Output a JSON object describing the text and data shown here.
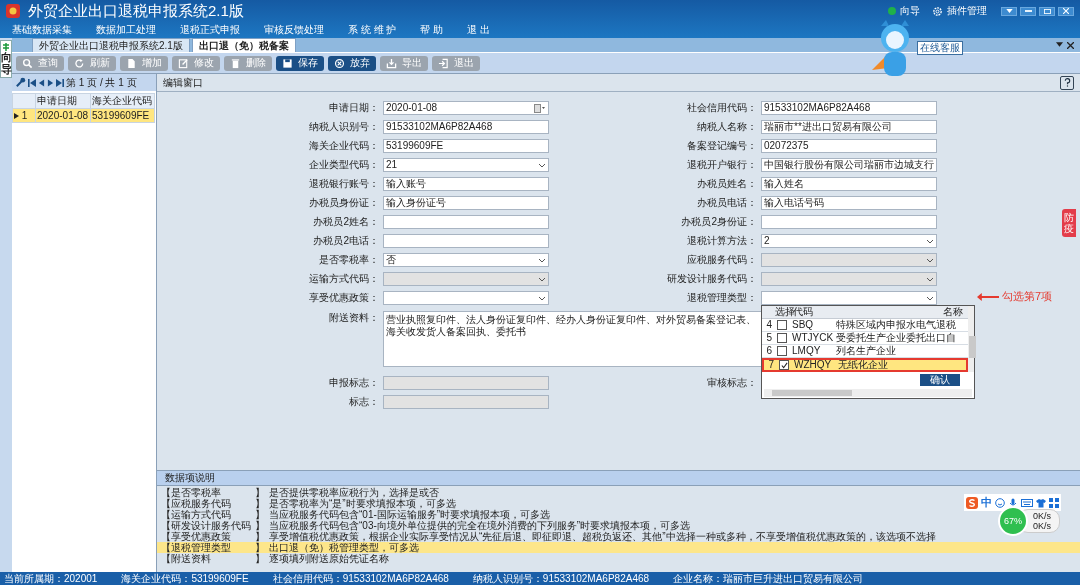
{
  "window": {
    "title": "外贸企业出口退税申报系统2.1版",
    "guide": "向导",
    "plugins": "插件管理"
  },
  "menu": [
    {
      "label": "基础数据采集"
    },
    {
      "label": "数据加工处理"
    },
    {
      "label": "退税正式申报"
    },
    {
      "label": "审核反馈处理"
    },
    {
      "label": "系 统 维 护"
    },
    {
      "label": "帮 助"
    },
    {
      "label": "退 出"
    }
  ],
  "mascot": {
    "label": "在线客服"
  },
  "side_tab": {
    "label": "向导"
  },
  "tabs": [
    {
      "label": "外贸企业出口退税申报系统2.1版",
      "selected": false
    },
    {
      "label": "出口退（免）税备案",
      "selected": true
    }
  ],
  "toolbar": [
    {
      "label": "查询",
      "kind": "search",
      "disabled": true
    },
    {
      "label": "刷新",
      "kind": "refresh",
      "disabled": true
    },
    {
      "label": "增加",
      "kind": "doc",
      "disabled": true
    },
    {
      "label": "修改",
      "kind": "edit",
      "disabled": true
    },
    {
      "label": "删除",
      "kind": "trash",
      "disabled": true
    },
    {
      "label": "保存",
      "kind": "save",
      "disabled": false
    },
    {
      "label": "放弃",
      "kind": "cancel",
      "disabled": false
    },
    {
      "label": "导出",
      "kind": "export",
      "disabled": true
    },
    {
      "label": "退出",
      "kind": "exit",
      "disabled": true
    }
  ],
  "pager": {
    "text": "第 1 页 / 共 1 页"
  },
  "list_table": {
    "columns": [
      "申请日期",
      "海关企业代码"
    ],
    "rows": [
      {
        "number": "1",
        "cells": [
          "2020-01-08",
          "53199609FE"
        ],
        "selected": true
      }
    ]
  },
  "edit_panel": {
    "title": "编辑窗口"
  },
  "form": {
    "rows": [
      {
        "left": {
          "label": "申请日期：",
          "value": "2020-01-08",
          "kind": "date",
          "disabled": false
        },
        "right": {
          "label": "社会信用代码：",
          "value": "91533102MA6P82A468",
          "kind": "text",
          "disabled": false
        }
      },
      {
        "left": {
          "label": "纳税人识别号：",
          "value": "91533102MA6P82A468",
          "kind": "text",
          "disabled": false
        },
        "right": {
          "label": "纳税人名称：",
          "value": "瑞丽市**进出口贸易有限公司",
          "kind": "text",
          "disabled": false
        }
      },
      {
        "left": {
          "label": "海关企业代码：",
          "value": "53199609FE",
          "kind": "text",
          "disabled": false
        },
        "right": {
          "label": "备案登记编号：",
          "value": "02072375",
          "kind": "text",
          "disabled": false
        }
      },
      {
        "left": {
          "label": "企业类型代码：",
          "value": "21",
          "kind": "select",
          "disabled": false
        },
        "right": {
          "label": "退税开户银行：",
          "value": "中国银行股份有限公司瑞丽市边城支行",
          "kind": "text",
          "disabled": false
        }
      },
      {
        "left": {
          "label": "退税银行账号：",
          "value": "输入账号",
          "kind": "text",
          "disabled": false
        },
        "right": {
          "label": "办税员姓名：",
          "value": "输入姓名",
          "kind": "text",
          "disabled": false
        }
      },
      {
        "left": {
          "label": "办税员身份证：",
          "value": "输入身份证号",
          "kind": "text",
          "disabled": false
        },
        "right": {
          "label": "办税员电话：",
          "value": "输入电话号码",
          "kind": "text",
          "disabled": false
        }
      },
      {
        "left": {
          "label": "办税员2姓名：",
          "kind": "text",
          "disabled": false
        },
        "right": {
          "label": "办税员2身份证：",
          "kind": "text",
          "disabled": false
        }
      },
      {
        "left": {
          "label": "办税员2电话：",
          "kind": "text",
          "disabled": false
        },
        "right": {
          "label": "退税计算方法：",
          "value": "2",
          "kind": "select",
          "disabled": false
        }
      },
      {
        "left": {
          "label": "是否零税率：",
          "value": "否",
          "kind": "select",
          "disabled": false
        },
        "right": {
          "label": "应税服务代码：",
          "kind": "select",
          "disabled": true
        }
      },
      {
        "left": {
          "label": "运输方式代码：",
          "kind": "select",
          "disabled": true
        },
        "right": {
          "label": "研发设计服务代码：",
          "kind": "select",
          "disabled": true
        }
      },
      {
        "left": {
          "label": "享受优惠政策：",
          "kind": "select",
          "disabled": false
        },
        "right": {
          "label": "退税管理类型：",
          "kind": "select",
          "disabled": false,
          "callout": "勾选第7项",
          "dropdown": {
            "columns": [
              "选择",
              "代码",
              "名称"
            ],
            "button": "确认",
            "rows": [
              {
                "number": "4",
                "checked": false,
                "code": "SBQ",
                "name": "特殊区域内申报水电气退税",
                "selected": false
              },
              {
                "number": "5",
                "checked": false,
                "code": "WTJYCK",
                "name": "受委托生产企业委托出口自",
                "selected": false
              },
              {
                "number": "6",
                "checked": false,
                "code": "LMQY",
                "name": "列名生产企业",
                "selected": false
              },
              {
                "number": "7",
                "checked": true,
                "code": "WZHQY",
                "name": "无纸化企业",
                "selected": true
              }
            ]
          }
        }
      },
      {
        "wide": {
          "label": "附送资料：",
          "value": "营业执照复印件、法人身份证复印件、经办人身份证复印件、对外贸易备案登记表、海关收发货人备案回执、委托书",
          "kind": "area",
          "disabled": false
        }
      },
      {
        "left": {
          "label": "申报标志：",
          "kind": "text",
          "disabled": true
        },
        "right": {
          "label": "审核标志："
        }
      },
      {
        "left": {
          "label": "标志：",
          "kind": "text",
          "disabled": true
        }
      }
    ]
  },
  "notes": {
    "title": "数据项说明",
    "items": [
      {
        "term": "【是否零税率",
        "close": "】",
        "text": "是否提供零税率应税行为，选择是或否",
        "selected": false
      },
      {
        "term": "【应税服务代码",
        "close": "】",
        "text": "是否零税率为“是”时要求填报本项，可多选",
        "selected": false
      },
      {
        "term": "【运输方式代码",
        "close": "】",
        "text": "当应税服务代码包含“01-国际运输服务”时要求填报本项，可多选",
        "selected": false
      },
      {
        "term": "【研发设计服务代码",
        "close": "】",
        "text": "当应税服务代码包含“03-向境外单位提供的完全在境外消费的下列服务”时要求填报本项，可多选",
        "selected": false
      },
      {
        "term": "【享受优惠政策",
        "close": "】",
        "text": "享受增值税优惠政策，根据企业实际享受情况从“先征后退、即征即退、超税负返还、其他”中选择一种或多种，不享受增值税优惠政策的，该选项不选择",
        "selected": false
      },
      {
        "term": "【退税管理类型",
        "close": "】",
        "text": "出口退（免）税管理类型，可多选",
        "selected": true
      },
      {
        "term": "【附送资料",
        "close": "】",
        "text": "逐项填列附送原始凭证名称",
        "selected": false
      }
    ]
  },
  "side_badge": {
    "label": "防疫"
  },
  "ime_bar": {
    "mode": "中"
  },
  "net_widget": {
    "percent": "67%",
    "up": "0K/s",
    "down": "0K/s"
  },
  "status_bar": [
    "当前所属期：202001",
    "海关企业代码：53199609FE",
    "社会信用代码：91533102MA6P82A468",
    "纳税人识别号：91533102MA6P82A468",
    "企业名称：瑞丽市巨升进出口贸易有限公司"
  ]
}
